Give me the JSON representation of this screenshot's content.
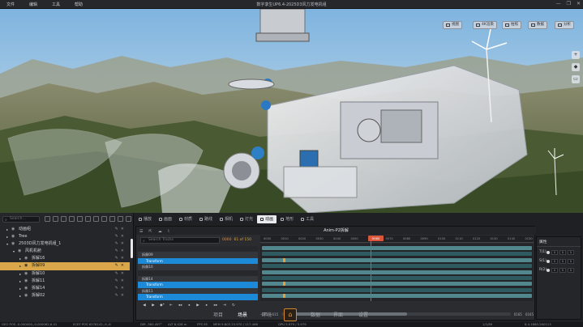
{
  "window": {
    "title": "数字孪生UP6.4-2025D3风力发电机组",
    "controls": [
      "—",
      "❐",
      "✕"
    ]
  },
  "menu": [
    "文件",
    "编辑",
    "工具",
    "帮助"
  ],
  "viewport_toolbar": [
    {
      "label": "视图",
      "icon": "view-icon"
    },
    {
      "label": "4K渲染",
      "icon": "render-icon"
    },
    {
      "label": "拍照",
      "icon": "camera-icon"
    },
    {
      "label": "数据",
      "icon": "data-icon"
    },
    {
      "label": "分析",
      "icon": "analysis-icon"
    }
  ],
  "right_dock": [
    "+",
    "◆",
    "▭"
  ],
  "scene_panel": {
    "search_placeholder": "Search...",
    "tree": [
      {
        "label": "动画组",
        "depth": 1,
        "expanded": false,
        "selected": false
      },
      {
        "label": "Tree",
        "depth": 1,
        "expanded": false,
        "selected": false
      },
      {
        "label": "2503D风力发电机组_1",
        "depth": 1,
        "expanded": true,
        "selected": false
      },
      {
        "label": "风机机舱",
        "depth": 2,
        "expanded": true,
        "selected": false
      },
      {
        "label": "拆解16",
        "depth": 3,
        "expanded": false,
        "selected": false
      },
      {
        "label": "拆解09",
        "depth": 3,
        "expanded": false,
        "selected": true
      },
      {
        "label": "拆解10",
        "depth": 3,
        "expanded": false,
        "selected": false
      },
      {
        "label": "拆解11",
        "depth": 3,
        "expanded": false,
        "selected": false
      },
      {
        "label": "拆解14",
        "depth": 3,
        "expanded": false,
        "selected": false
      },
      {
        "label": "拆解02",
        "depth": 3,
        "expanded": false,
        "selected": false
      }
    ]
  },
  "editor_tabs": [
    {
      "label": "播放",
      "active": false
    },
    {
      "label": "画面",
      "active": false
    },
    {
      "label": "材质",
      "active": false
    },
    {
      "label": "路线",
      "active": false
    },
    {
      "label": "相机",
      "active": false
    },
    {
      "label": "灯光",
      "active": false
    },
    {
      "label": "动画",
      "active": true
    },
    {
      "label": "地形",
      "active": false
    },
    {
      "label": "工具",
      "active": false
    }
  ],
  "animation": {
    "title": "Anim-P2拆解",
    "search_placeholder": "Search Tracks",
    "frame_current": "0060",
    "frame_info": "61 of 150",
    "playhead_label": "0060",
    "tracks": [
      {
        "label": "",
        "kind": "dark"
      },
      {
        "label": "拆解09",
        "kind": "grp"
      },
      {
        "label": "Transform",
        "kind": "tf"
      },
      {
        "label": "拆解10",
        "kind": "grp"
      },
      {
        "label": "",
        "kind": "dark"
      },
      {
        "label": "拆解14",
        "kind": "grp"
      },
      {
        "label": "Transform",
        "kind": "tf"
      },
      {
        "label": "拆解11",
        "kind": "grp"
      },
      {
        "label": "Transform",
        "kind": "tf"
      }
    ],
    "ruler_ticks": [
      "0000",
      "0010",
      "0020",
      "0030",
      "0040",
      "0050",
      "0060",
      "0070",
      "0080",
      "0090",
      "0100",
      "0110",
      "0120",
      "0130",
      "0140",
      "0150"
    ],
    "controls": {
      "start_left": "-015",
      "start_right": "-015",
      "end_left": "0165",
      "end_right": "0165",
      "buttons": [
        "◀",
        "▶",
        "◆*",
        "⇤",
        "◂◂",
        "◂",
        "▶",
        "▸",
        "▸▸",
        "⇥",
        "↻"
      ]
    }
  },
  "properties": {
    "title": "属性",
    "rows": [
      {
        "key": "T(1)",
        "values": [
          "1",
          "1",
          "1"
        ]
      },
      {
        "key": "S(1)",
        "values": [
          "1",
          "1",
          "1"
        ]
      },
      {
        "key": "R(2)",
        "values": [
          "1",
          "1",
          "1"
        ]
      }
    ]
  },
  "modes": [
    {
      "label": "项目",
      "active": false
    },
    {
      "label": "场景",
      "active": true
    },
    {
      "label": "环境",
      "active": false
    },
    {
      "label": "数据",
      "active": false
    },
    {
      "label": "界面",
      "active": false
    },
    {
      "label": "设置",
      "active": false
    }
  ],
  "status": {
    "geo": "GEO POS -0.000000,-0.000062,6.41",
    "ecef": "ECEF POS 6378142,-9,-6",
    "dir": "DIR -360.497°",
    "alt": "ALT 8.428 m",
    "fps": "FPS 95",
    "mem": "MEM 9.803 23.970 / 117.466",
    "gpu": "GPU 5.979 / 5.979",
    "view": "1/1/89",
    "coord": "6.4.1860.260113"
  }
}
